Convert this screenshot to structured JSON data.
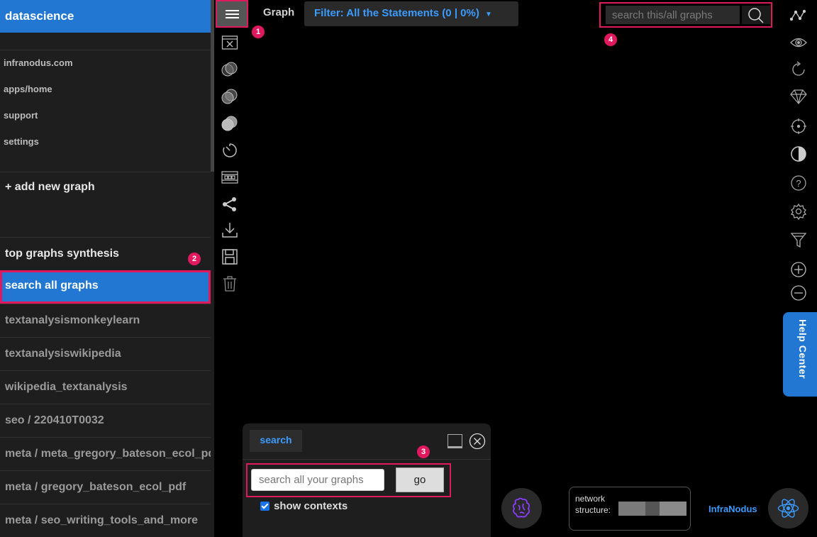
{
  "sidebar": {
    "title": "datascience",
    "links": [
      "infranodus.com",
      "apps/home",
      "support",
      "settings"
    ],
    "add_graph": "+ add new graph",
    "items": [
      "top graphs synthesis",
      "search all graphs",
      "textanalysismonkeylearn",
      "textanalysiswikipedia",
      "wikipedia_textanalysis",
      "seo / 220410T0032",
      "meta / meta_gregory_bateson_ecol_pdf",
      "meta / gregory_bateson_ecol_pdf",
      "meta / seo_writing_tools_and_more"
    ],
    "active_item": "search all graphs"
  },
  "topbar": {
    "graph_label": "Graph",
    "filter_label": "Filter: All the Statements (0 | 0%)",
    "search_placeholder": "search this/all graphs"
  },
  "left_toolbar_icons": [
    "menu-icon",
    "close-window-icon",
    "circles-light-icon",
    "circles-mid-icon",
    "circles-dark-icon",
    "timer-icon",
    "film-icon",
    "share-icon",
    "download-icon",
    "save-icon",
    "trash-icon"
  ],
  "right_toolbar_icons": [
    "graph-icon",
    "eye-icon",
    "refresh-icon",
    "diamond-icon",
    "target-icon",
    "contrast-icon",
    "help-icon",
    "settings-icon",
    "filter-icon",
    "zoom-in-icon",
    "zoom-out-icon"
  ],
  "help_center": "Help Center",
  "badges": [
    "1",
    "2",
    "3",
    "4"
  ],
  "search_panel": {
    "tab": "search",
    "input_placeholder": "search all your graphs",
    "go_label": "go",
    "checkbox_label": "show contexts",
    "checkbox_checked": true
  },
  "network": {
    "label": "network structure:"
  },
  "brand": "InfraNodus",
  "colors": {
    "accent_blue": "#2177d2",
    "link_blue": "#3b9bff",
    "highlight": "#e0195f",
    "background": "#000000",
    "sidebar_bg": "#1e1e1e"
  }
}
